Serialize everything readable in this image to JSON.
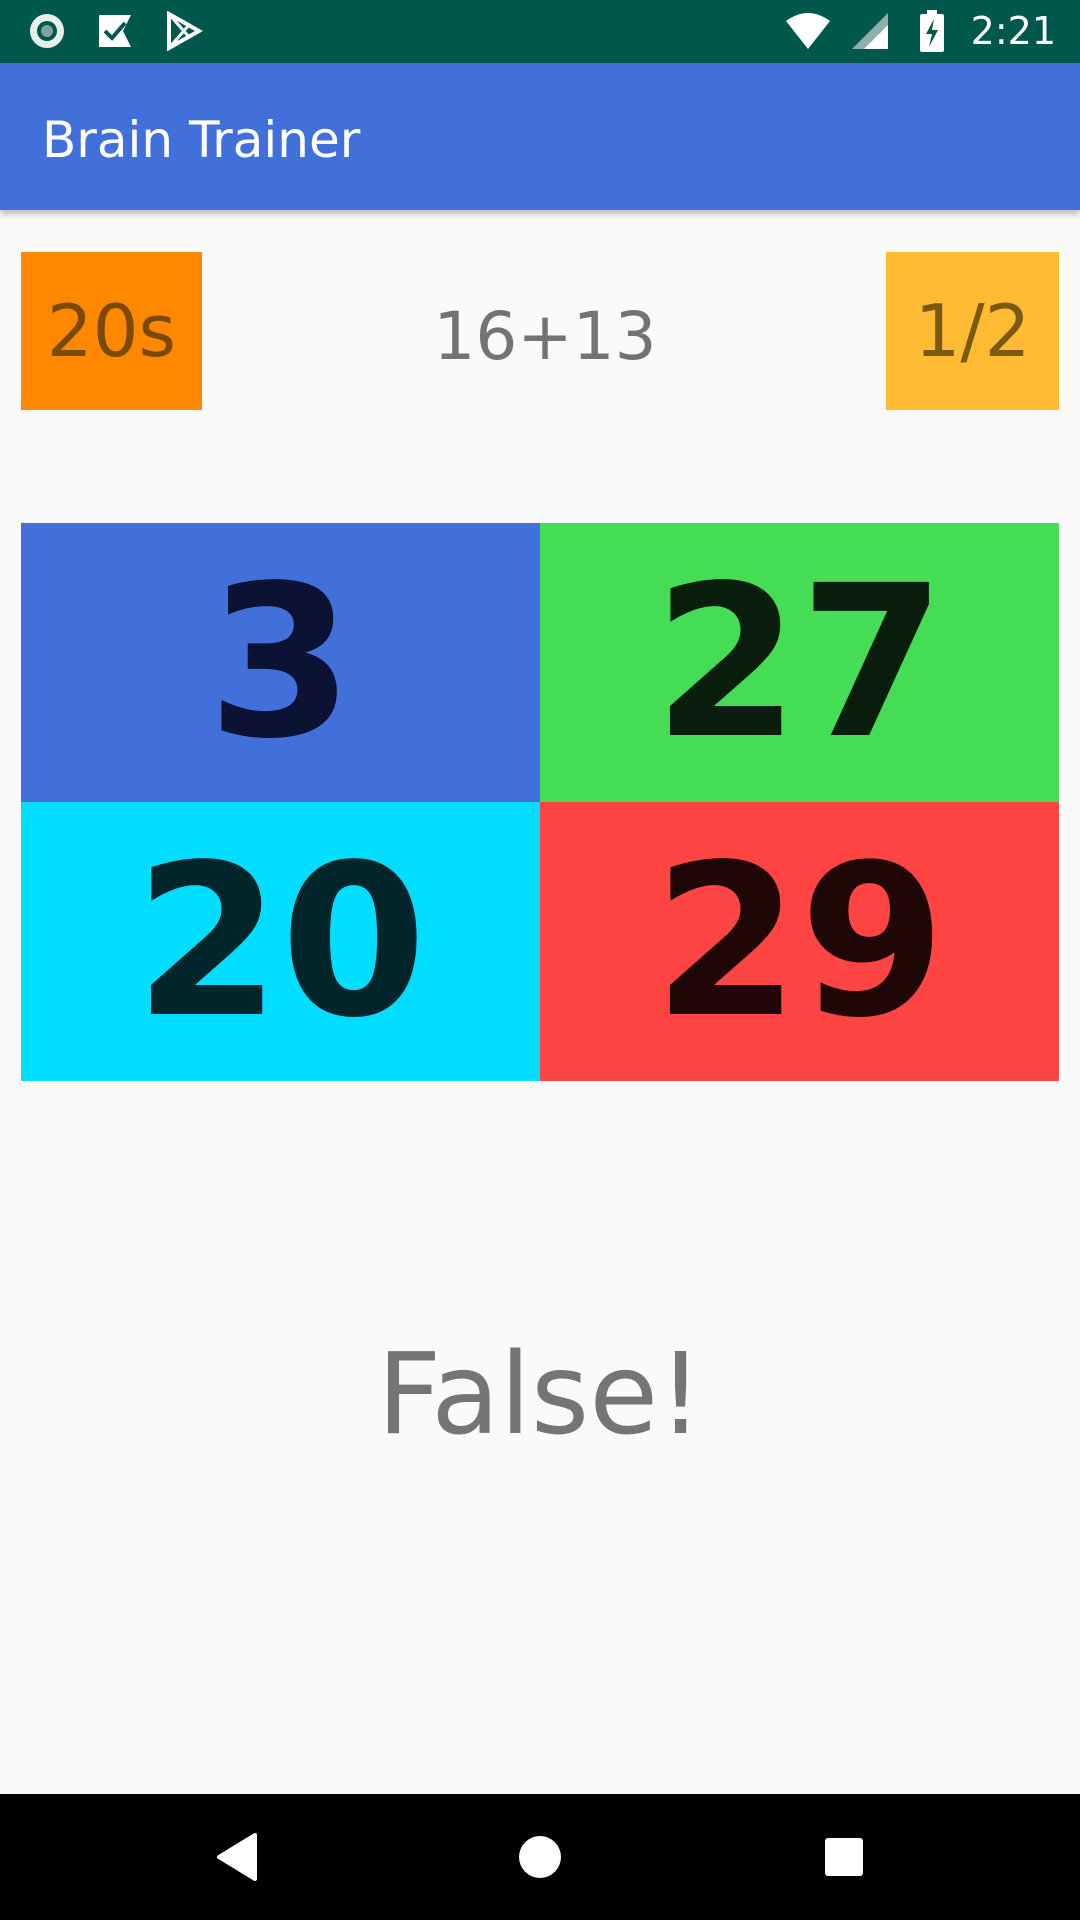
{
  "status_bar": {
    "time": "2:21",
    "left_icons": [
      "record-icon",
      "check-flag-icon",
      "play-store-icon"
    ],
    "right_icons": [
      "wifi-icon",
      "cell-signal-icon",
      "battery-charging-icon"
    ]
  },
  "app_bar": {
    "title": "Brain Trainer",
    "color": "#4270db"
  },
  "game": {
    "timer": {
      "text": "20s",
      "color": "#ff8800"
    },
    "question": "16+13",
    "score": {
      "text": "1/2",
      "color": "#ffbb33"
    },
    "answers": [
      {
        "value": "3",
        "color": "#4270db",
        "text_color": "#0b1233"
      },
      {
        "value": "27",
        "color": "#44dd55",
        "text_color": "#0a1e0d"
      },
      {
        "value": "20",
        "color": "#00ddff",
        "text_color": "#00262c"
      },
      {
        "value": "29",
        "color": "#ff4444",
        "text_color": "#200707"
      }
    ],
    "result": "False!"
  },
  "nav_bar": {
    "buttons": [
      "back-icon",
      "home-icon",
      "recents-icon"
    ]
  }
}
